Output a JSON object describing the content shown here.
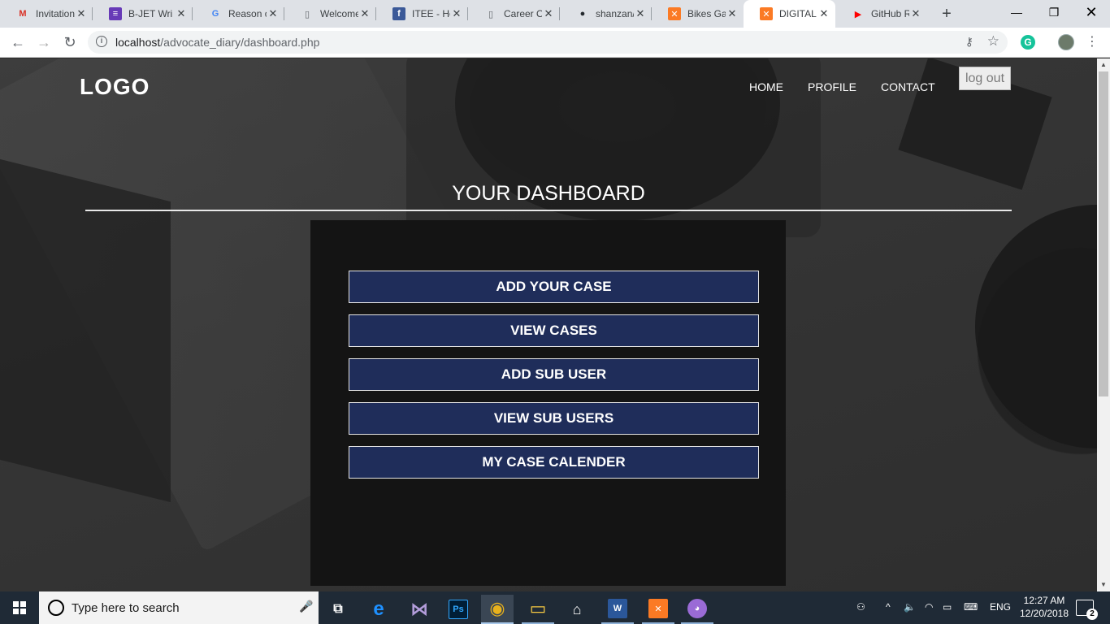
{
  "browser": {
    "tabs": [
      {
        "title": "Invitation",
        "icon": "gmail-icon",
        "icon_glyph": "M",
        "icon_color": "#d93025"
      },
      {
        "title": "B-JET Wri",
        "icon": "forms-icon",
        "icon_glyph": "≡",
        "icon_color": "#673ab7"
      },
      {
        "title": "Reason o",
        "icon": "google-icon",
        "icon_glyph": "G",
        "icon_color": "#4285f4"
      },
      {
        "title": "Welcome",
        "icon": "page-icon",
        "icon_glyph": "▯",
        "icon_color": "#5f6368"
      },
      {
        "title": "ITEE - Ho",
        "icon": "facebook-icon",
        "icon_glyph": "f",
        "icon_color": "#3b5998"
      },
      {
        "title": "Career O",
        "icon": "page-icon",
        "icon_glyph": "▯",
        "icon_color": "#5f6368"
      },
      {
        "title": "shanzan/",
        "icon": "github-icon",
        "icon_glyph": "●",
        "icon_color": "#24292e"
      },
      {
        "title": "Bikes Ga",
        "icon": "xampp-icon",
        "icon_glyph": "✕",
        "icon_color": "#fb7a24"
      },
      {
        "title": "DIGITAL /",
        "icon": "xampp-icon",
        "icon_glyph": "✕",
        "icon_color": "#fb7a24",
        "active": true
      },
      {
        "title": "GitHub R",
        "icon": "youtube-icon",
        "icon_glyph": "▶",
        "icon_color": "#ff0000"
      }
    ],
    "url_host": "localhost",
    "url_path": "/advocate_diary/dashboard.php"
  },
  "page": {
    "logo": "LOGO",
    "nav": {
      "home": "HOME",
      "profile": "PROFILE",
      "contact": "CONTACT"
    },
    "logout_label": "log out",
    "title": "YOUR DASHBOARD",
    "buttons": [
      "ADD YOUR CASE",
      "VIEW CASES",
      "ADD SUB USER",
      "VIEW SUB USERS",
      "MY CASE CALENDER"
    ],
    "colors": {
      "button_bg": "#1f2d5a",
      "panel_bg": "#141414"
    }
  },
  "taskbar": {
    "search_placeholder": "Type here to search",
    "apps": [
      {
        "name": "task-view-icon",
        "glyph": "⧉",
        "color": "#ffffff"
      },
      {
        "name": "edge-icon",
        "glyph": "e",
        "color": "#1e90ff"
      },
      {
        "name": "visual-studio-icon",
        "glyph": "⋈",
        "color": "#b39ddb"
      },
      {
        "name": "photoshop-icon",
        "glyph": "Ps",
        "color": "#31a8ff"
      },
      {
        "name": "chrome-icon",
        "glyph": "◉",
        "color": "#e8b11c"
      },
      {
        "name": "file-explorer-icon",
        "glyph": "▭",
        "color": "#f5c842"
      },
      {
        "name": "store-icon",
        "glyph": "🛍",
        "color": "#ffffff"
      },
      {
        "name": "word-icon",
        "glyph": "W",
        "color": "#2b579a"
      },
      {
        "name": "xampp-icon",
        "glyph": "✕",
        "color": "#fb7a24"
      },
      {
        "name": "github-desktop-icon",
        "glyph": "◕",
        "color": "#9a6bd6"
      }
    ],
    "language": "ENG",
    "time": "12:27 AM",
    "date": "12/20/2018",
    "notification_count": "2"
  }
}
